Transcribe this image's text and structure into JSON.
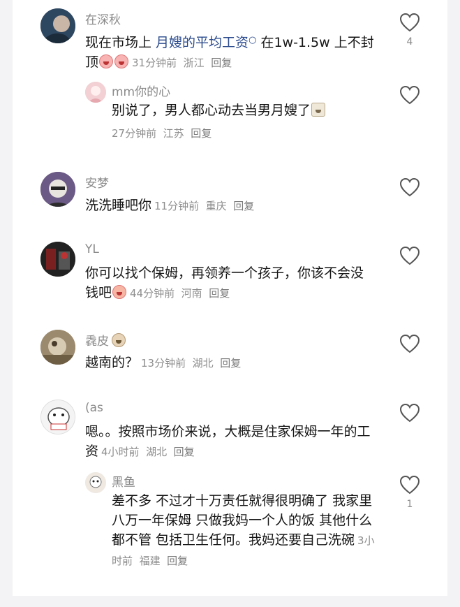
{
  "comments": [
    {
      "user": "在深秋",
      "text_before_link": "现在市场上 ",
      "link_text": "月嫂的平均工资",
      "text_after_link": " 在1w-1.5w 上不封顶",
      "time": "31分钟前",
      "location": "浙江",
      "reply_label": "回复",
      "likes": "4",
      "emojis": [
        "rage-face-emoji",
        "rage-face-emoji"
      ],
      "replies": [
        {
          "user": "mm你的心",
          "text": "别说了，男人都心动去当男月嫂了",
          "time": "27分钟前",
          "location": "江苏",
          "reply_label": "回复"
        }
      ]
    },
    {
      "user": "安梦",
      "text": "洗洗睡吧你",
      "time": "11分钟前",
      "location": "重庆",
      "reply_label": "回复"
    },
    {
      "user": "YL",
      "text": "你可以找个保姆，再领养一个孩子，你该不会没钱吧",
      "time": "44分钟前",
      "location": "河南",
      "reply_label": "回复"
    },
    {
      "user": "毳皮",
      "text": "越南的？",
      "time": "13分钟前",
      "location": "湖北",
      "reply_label": "回复"
    },
    {
      "user": "(as",
      "text": "嗯。。按照市场价来说，大概是住家保姆一年的工资",
      "time": "4小时前",
      "location": "湖北",
      "reply_label": "回复",
      "replies": [
        {
          "user": "黑鱼",
          "text": "差不多 不过才十万责任就得很明确了 我家里八万一年保姆 只做我妈一个人的饭 其他什么都不管 包括卫生任何。我妈还要自己洗碗",
          "time": "3小时前",
          "location": "福建",
          "reply_label": "回复",
          "likes": "1"
        }
      ]
    }
  ],
  "icons": {
    "like": "heart-outline-icon",
    "search": "search-glyph-icon"
  },
  "colors": {
    "link": "#2a4a8c",
    "meta": "#8e8e8e",
    "text": "#161616",
    "background": "#ffffff"
  }
}
